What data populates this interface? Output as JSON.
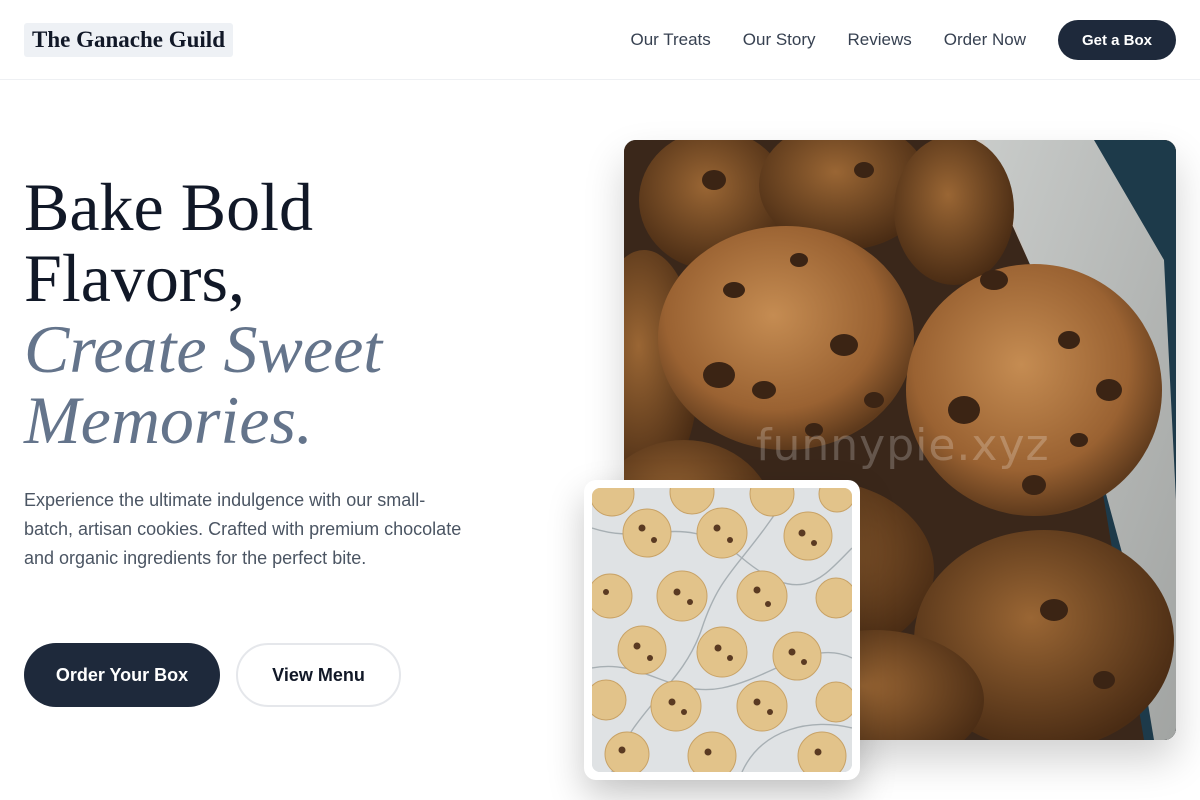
{
  "brand": {
    "name": "The Ganache Guild"
  },
  "nav": {
    "links": [
      "Our Treats",
      "Our Story",
      "Reviews",
      "Order Now"
    ],
    "cta": "Get a Box"
  },
  "hero": {
    "headline_line1": "Bake Bold",
    "headline_line2": "Flavors,",
    "headline_accent1": "Create Sweet",
    "headline_accent2": "Memories.",
    "lead": "Experience the ultimate indulgence with our small-batch, artisan cookies. Crafted with premium chocolate and organic ingredients for the perfect bite.",
    "primary_button": "Order Your Box",
    "secondary_button": "View Menu"
  },
  "images": {
    "main_alt": "Chocolate chip cookies piled in a paper-lined box",
    "inset_alt": "Rows of chocolate chip cookies on a marble surface",
    "watermark": "funnypie.xyz"
  },
  "colors": {
    "primary": "#1e293b",
    "accent_text": "#64748b",
    "body_text": "#4b5563"
  }
}
